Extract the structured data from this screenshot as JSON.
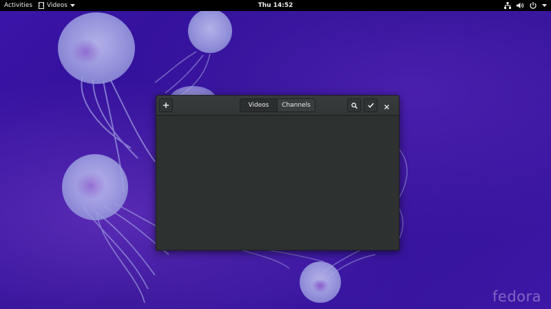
{
  "topbar": {
    "activities_label": "Activities",
    "app_menu_label": "Videos",
    "clock": "Thu 14:52"
  },
  "window": {
    "tabs": [
      {
        "label": "Videos",
        "active": true
      },
      {
        "label": "Channels",
        "active": false
      }
    ]
  },
  "wallpaper": {
    "logo_text": "fedora"
  },
  "colors": {
    "topbar": "#000000",
    "window_bg": "#2d3130",
    "wallpaper": "#3b14a8",
    "jellyfish": "#b0b4ec"
  },
  "icons": [
    "film-icon",
    "dropdown-arrow-icon",
    "network-icon",
    "volume-icon",
    "power-icon",
    "add-icon",
    "search-icon",
    "checkmark-icon",
    "close-icon"
  ]
}
